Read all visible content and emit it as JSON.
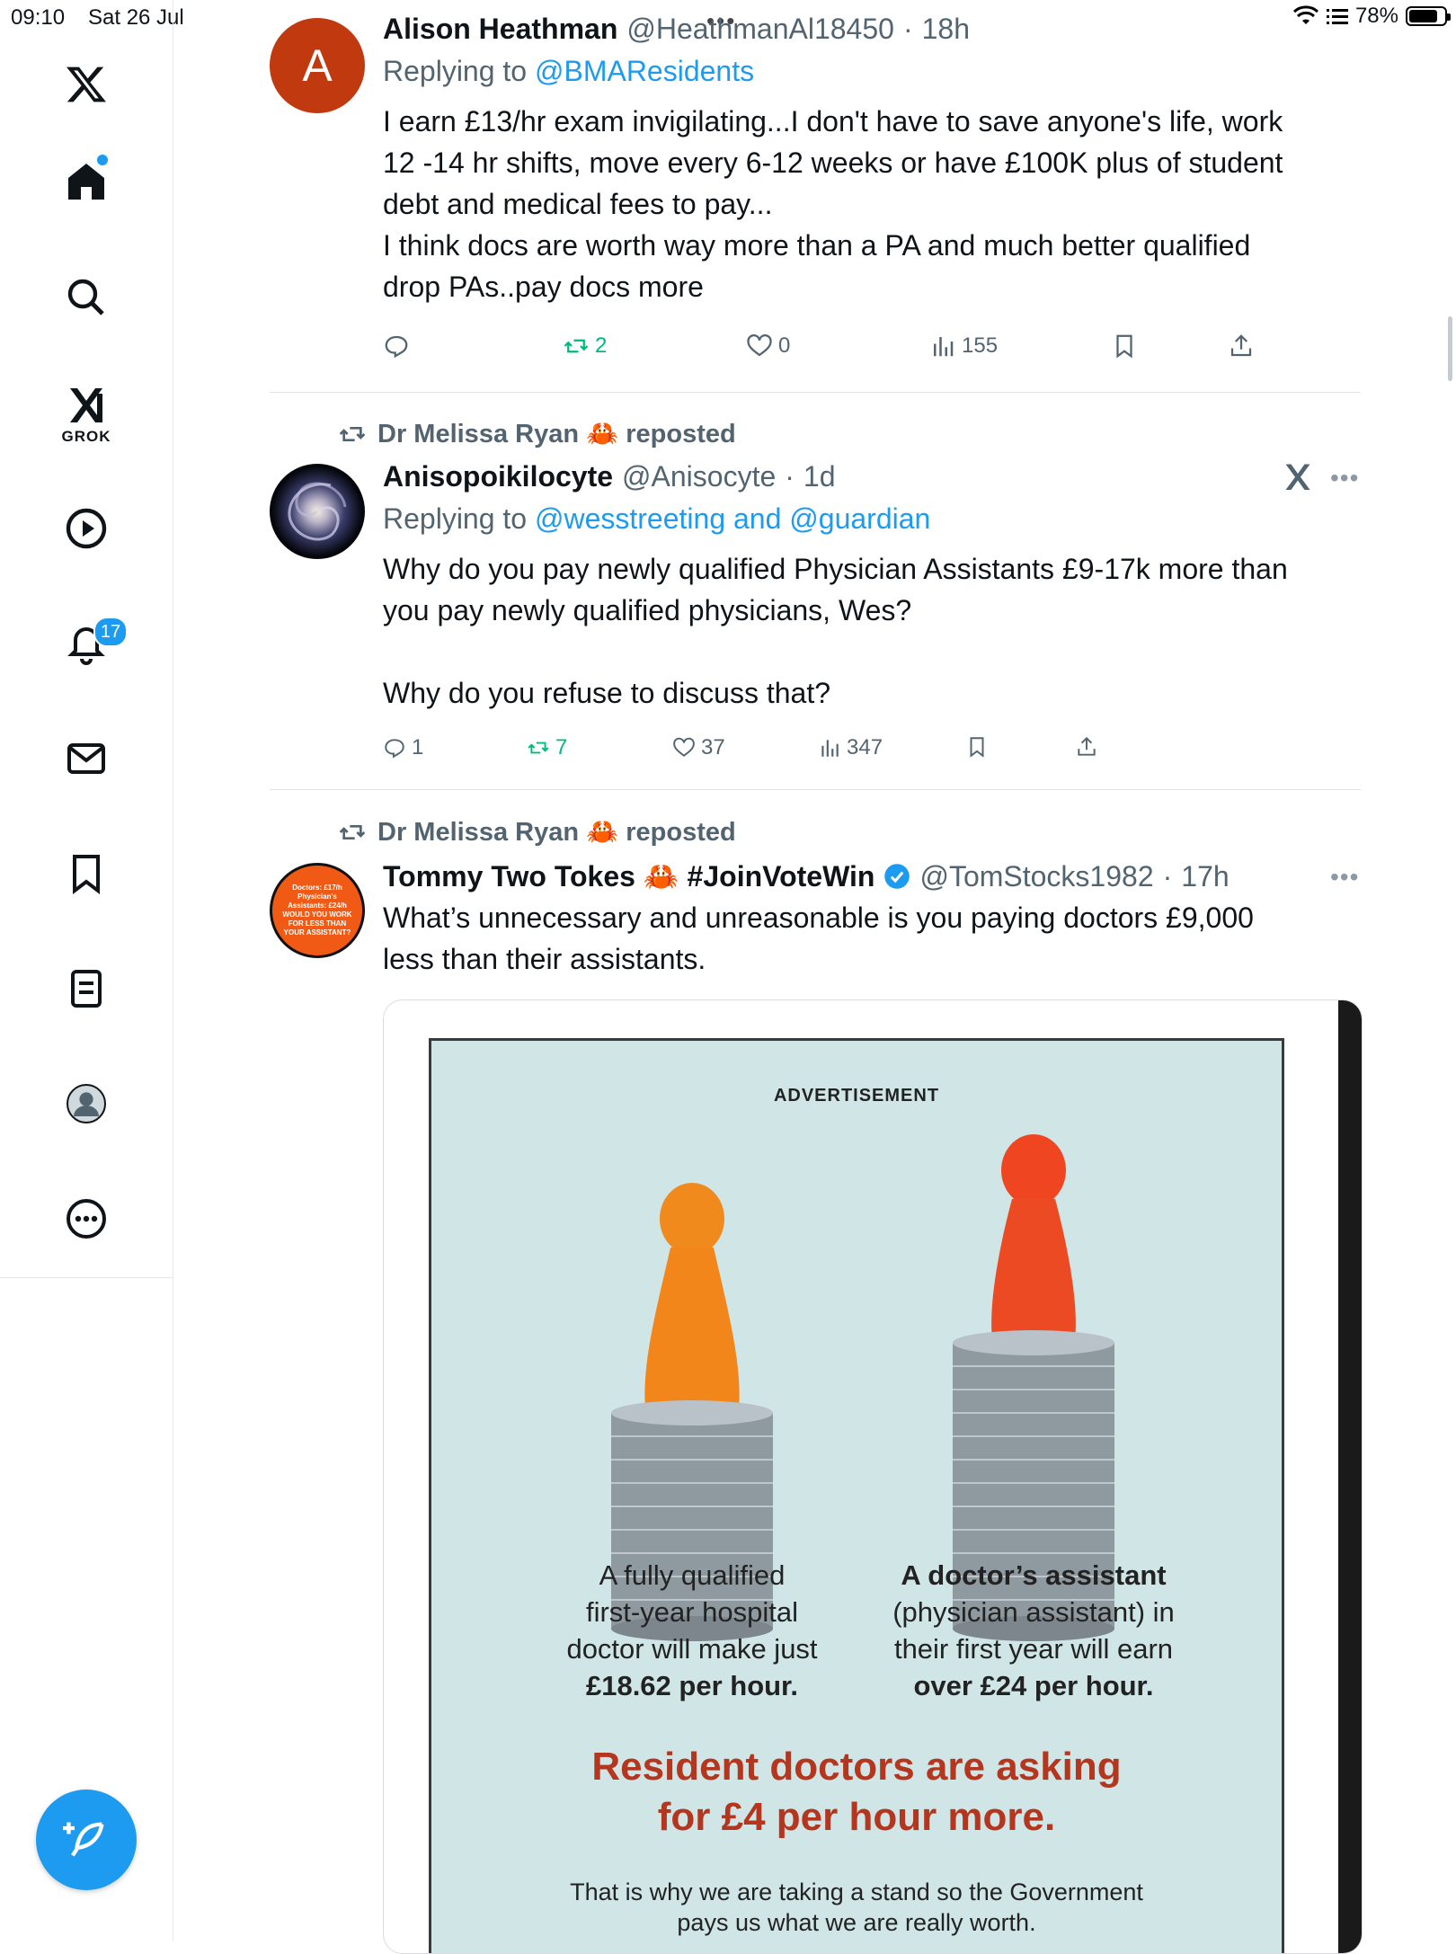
{
  "status_bar": {
    "time": "09:10",
    "date": "Sat 26 Jul",
    "battery": "78%",
    "battery_level": 0.78
  },
  "sidebar": {
    "items": [
      {
        "name": "x-logo"
      },
      {
        "name": "home"
      },
      {
        "name": "search"
      },
      {
        "name": "grok",
        "label": "GROK"
      },
      {
        "name": "videos"
      },
      {
        "name": "notifications",
        "badge": "17"
      },
      {
        "name": "messages"
      },
      {
        "name": "bookmarks"
      },
      {
        "name": "lists"
      },
      {
        "name": "profile"
      },
      {
        "name": "more"
      }
    ]
  },
  "tweets": [
    {
      "name": "Alison Heathman",
      "handle": "@HeathmanAl18450",
      "time": "18h",
      "avatar_letter": "A",
      "avatar_color": "#c1390f",
      "replying_prefix": "Replying to",
      "replying_to": "@BMAResidents",
      "body": "I earn £13/hr exam invigilating...I don't have to save anyone's life, work\n12 -14 hr shifts, move every 6-12 weeks or have £100K plus of student\ndebt and medical fees to pay...\nI think docs are worth way more than a PA and much better qualified\ndrop PAs..pay docs more",
      "replies": "",
      "reposts": "2",
      "likes": "0",
      "views": "155"
    },
    {
      "repost_by": "Dr Melissa Ryan 🦀 reposted",
      "name": "Anisopoikilocyte",
      "handle": "@Anisocyte",
      "time": "1d",
      "replying_prefix": "Replying to",
      "replying_to": "@wesstreeting and @guardian",
      "body": "Why do you pay newly qualified Physician Assistants £9-17k more than\nyou pay newly qualified physicians, Wes?\n\nWhy do you refuse to discuss that?",
      "replies": "1",
      "reposts": "7",
      "likes": "37",
      "views": "347"
    },
    {
      "repost_by": "Dr Melissa Ryan 🦀 reposted",
      "name": "Tommy Two Tokes 🦀 #JoinVoteWin",
      "handle": "@TomStocks1982",
      "time": "17h",
      "avatar_text": "Doctors: £17/h\nPhysician's Assistants: £24/h\nWOULD YOU WORK FOR LESS THAN YOUR ASSISTANT?",
      "body": "What’s unnecessary and unreasonable is you paying doctors £9,000\nless than their assistants.",
      "media": {
        "advertisement_label": "ADVERTISEMENT",
        "caption_left_1": "A fully qualified",
        "caption_left_2": "first-year hospital",
        "caption_left_3": "doctor will make just",
        "caption_left_4": "£18.62 per hour.",
        "caption_right_1": "A doctor’s assistant",
        "caption_right_2": "(physician assistant) in",
        "caption_right_3": "their first year will earn",
        "caption_right_4": "over £24 per hour.",
        "headline_1": "Resident doctors are asking",
        "headline_2": "for £4 per hour more.",
        "sub_1": "That is why we are taking a stand so the Government",
        "sub_2": "pays us what we are really worth."
      }
    }
  ]
}
